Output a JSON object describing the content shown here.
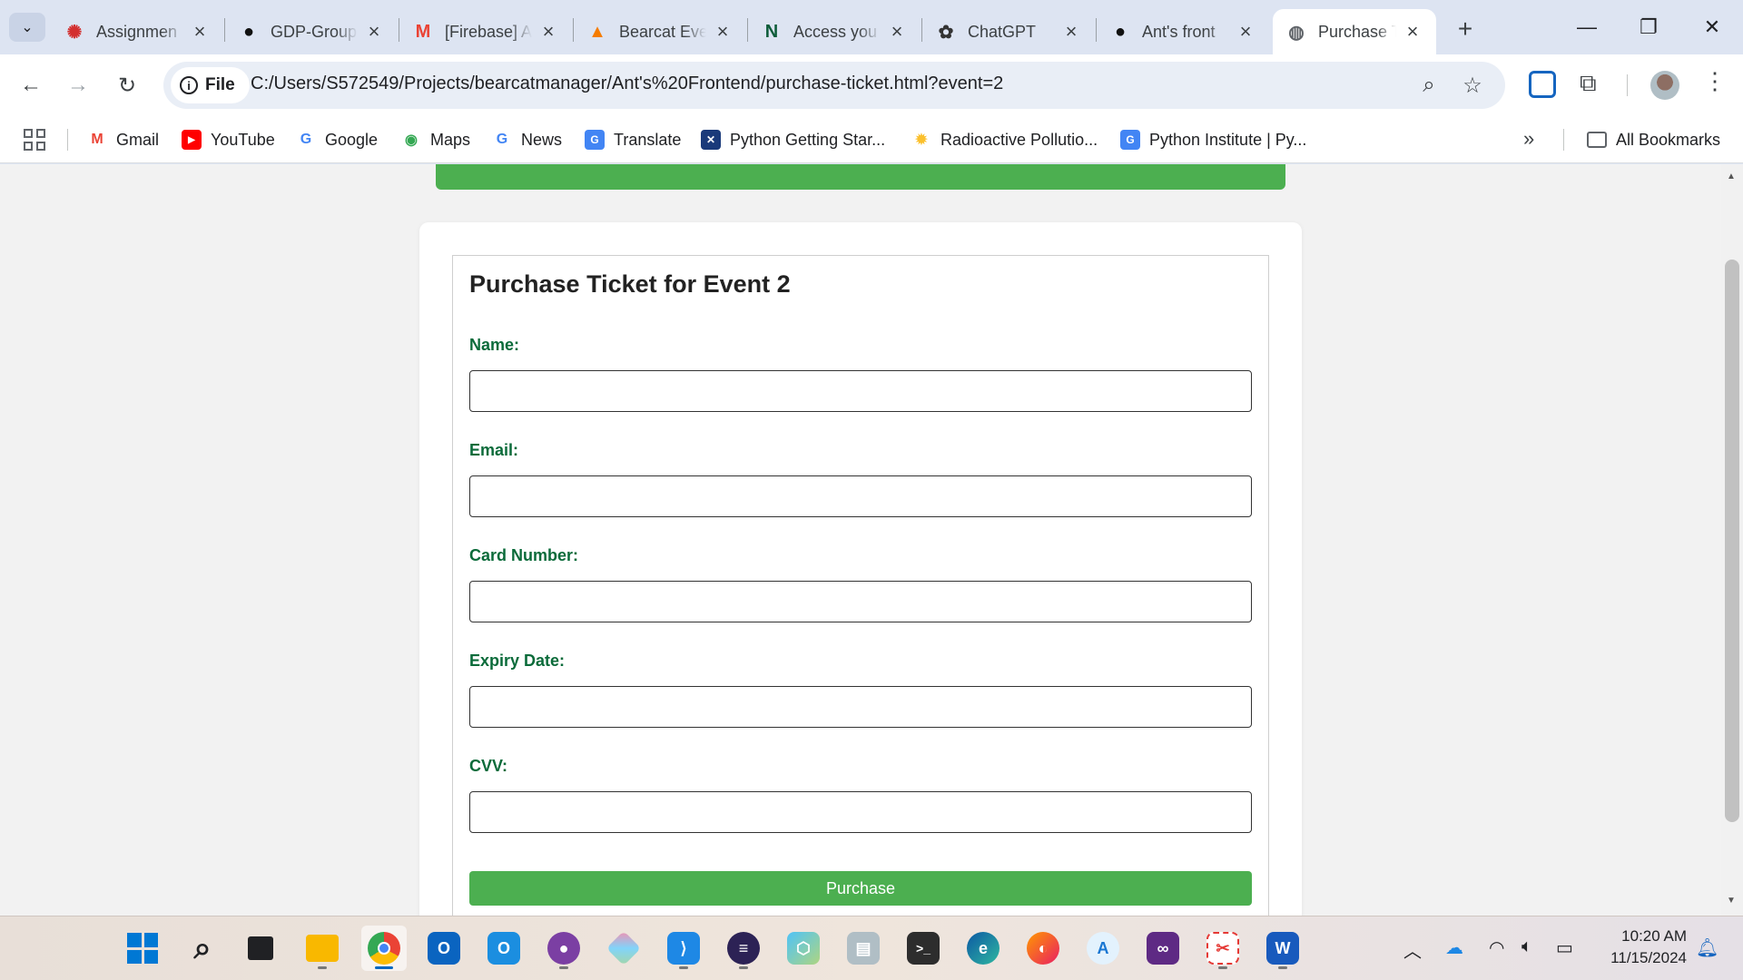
{
  "tabs": [
    {
      "title": "Assignmen",
      "icon": "assignment-icon"
    },
    {
      "title": "GDP-Group",
      "icon": "github-icon"
    },
    {
      "title": "[Firebase] A",
      "icon": "gmail-icon"
    },
    {
      "title": "Bearcat Eve",
      "icon": "firebase-icon"
    },
    {
      "title": "Access you",
      "icon": "n-logo-icon"
    },
    {
      "title": "ChatGPT",
      "icon": "chatgpt-icon"
    },
    {
      "title": "Ant's front",
      "icon": "github-icon"
    },
    {
      "title": "Purchase T",
      "icon": "globe-icon",
      "active": true
    }
  ],
  "address_bar": {
    "chip_label": "File",
    "url": "C:/Users/S572549/Projects/bearcatmanager/Ant's%20Frontend/purchase-ticket.html?event=2"
  },
  "bookmarks": [
    {
      "label": "Gmail"
    },
    {
      "label": "YouTube"
    },
    {
      "label": "Google"
    },
    {
      "label": "Maps"
    },
    {
      "label": "News"
    },
    {
      "label": "Translate"
    },
    {
      "label": "Python Getting Star..."
    },
    {
      "label": "Radioactive Pollutio..."
    },
    {
      "label": "Python Institute | Py..."
    }
  ],
  "all_bookmarks_label": "All Bookmarks",
  "form": {
    "title": "Purchase Ticket for Event 2",
    "fields": [
      {
        "label": "Name:",
        "value": ""
      },
      {
        "label": "Email:",
        "value": ""
      },
      {
        "label": "Card Number:",
        "value": ""
      },
      {
        "label": "Expiry Date:",
        "value": ""
      },
      {
        "label": "CVV:",
        "value": ""
      }
    ],
    "submit_label": "Purchase"
  },
  "colors": {
    "accent_green": "#4caf50",
    "label_green": "#0b6b3a"
  },
  "clock": {
    "time": "10:20 AM",
    "date": "11/15/2024"
  }
}
